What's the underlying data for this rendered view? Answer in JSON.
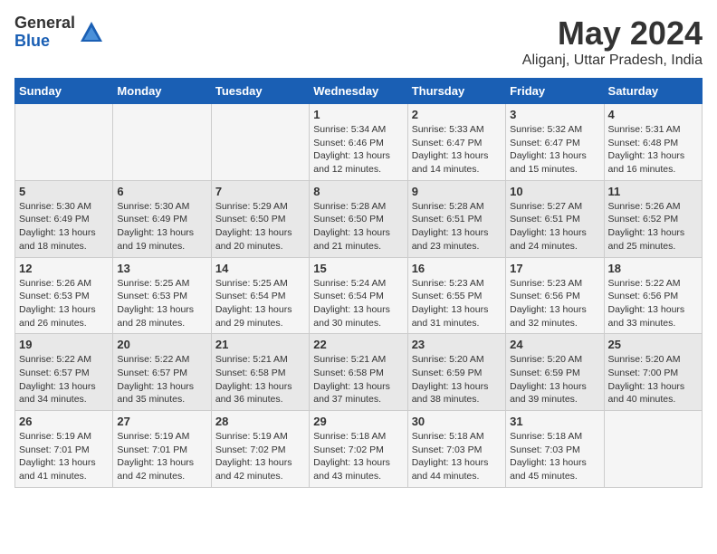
{
  "logo": {
    "general": "General",
    "blue": "Blue"
  },
  "title": "May 2024",
  "location": "Aliganj, Uttar Pradesh, India",
  "weekdays": [
    "Sunday",
    "Monday",
    "Tuesday",
    "Wednesday",
    "Thursday",
    "Friday",
    "Saturday"
  ],
  "weeks": [
    [
      {
        "day": "",
        "info": ""
      },
      {
        "day": "",
        "info": ""
      },
      {
        "day": "",
        "info": ""
      },
      {
        "day": "1",
        "info": "Sunrise: 5:34 AM\nSunset: 6:46 PM\nDaylight: 13 hours\nand 12 minutes."
      },
      {
        "day": "2",
        "info": "Sunrise: 5:33 AM\nSunset: 6:47 PM\nDaylight: 13 hours\nand 14 minutes."
      },
      {
        "day": "3",
        "info": "Sunrise: 5:32 AM\nSunset: 6:47 PM\nDaylight: 13 hours\nand 15 minutes."
      },
      {
        "day": "4",
        "info": "Sunrise: 5:31 AM\nSunset: 6:48 PM\nDaylight: 13 hours\nand 16 minutes."
      }
    ],
    [
      {
        "day": "5",
        "info": "Sunrise: 5:30 AM\nSunset: 6:49 PM\nDaylight: 13 hours\nand 18 minutes."
      },
      {
        "day": "6",
        "info": "Sunrise: 5:30 AM\nSunset: 6:49 PM\nDaylight: 13 hours\nand 19 minutes."
      },
      {
        "day": "7",
        "info": "Sunrise: 5:29 AM\nSunset: 6:50 PM\nDaylight: 13 hours\nand 20 minutes."
      },
      {
        "day": "8",
        "info": "Sunrise: 5:28 AM\nSunset: 6:50 PM\nDaylight: 13 hours\nand 21 minutes."
      },
      {
        "day": "9",
        "info": "Sunrise: 5:28 AM\nSunset: 6:51 PM\nDaylight: 13 hours\nand 23 minutes."
      },
      {
        "day": "10",
        "info": "Sunrise: 5:27 AM\nSunset: 6:51 PM\nDaylight: 13 hours\nand 24 minutes."
      },
      {
        "day": "11",
        "info": "Sunrise: 5:26 AM\nSunset: 6:52 PM\nDaylight: 13 hours\nand 25 minutes."
      }
    ],
    [
      {
        "day": "12",
        "info": "Sunrise: 5:26 AM\nSunset: 6:53 PM\nDaylight: 13 hours\nand 26 minutes."
      },
      {
        "day": "13",
        "info": "Sunrise: 5:25 AM\nSunset: 6:53 PM\nDaylight: 13 hours\nand 28 minutes."
      },
      {
        "day": "14",
        "info": "Sunrise: 5:25 AM\nSunset: 6:54 PM\nDaylight: 13 hours\nand 29 minutes."
      },
      {
        "day": "15",
        "info": "Sunrise: 5:24 AM\nSunset: 6:54 PM\nDaylight: 13 hours\nand 30 minutes."
      },
      {
        "day": "16",
        "info": "Sunrise: 5:23 AM\nSunset: 6:55 PM\nDaylight: 13 hours\nand 31 minutes."
      },
      {
        "day": "17",
        "info": "Sunrise: 5:23 AM\nSunset: 6:56 PM\nDaylight: 13 hours\nand 32 minutes."
      },
      {
        "day": "18",
        "info": "Sunrise: 5:22 AM\nSunset: 6:56 PM\nDaylight: 13 hours\nand 33 minutes."
      }
    ],
    [
      {
        "day": "19",
        "info": "Sunrise: 5:22 AM\nSunset: 6:57 PM\nDaylight: 13 hours\nand 34 minutes."
      },
      {
        "day": "20",
        "info": "Sunrise: 5:22 AM\nSunset: 6:57 PM\nDaylight: 13 hours\nand 35 minutes."
      },
      {
        "day": "21",
        "info": "Sunrise: 5:21 AM\nSunset: 6:58 PM\nDaylight: 13 hours\nand 36 minutes."
      },
      {
        "day": "22",
        "info": "Sunrise: 5:21 AM\nSunset: 6:58 PM\nDaylight: 13 hours\nand 37 minutes."
      },
      {
        "day": "23",
        "info": "Sunrise: 5:20 AM\nSunset: 6:59 PM\nDaylight: 13 hours\nand 38 minutes."
      },
      {
        "day": "24",
        "info": "Sunrise: 5:20 AM\nSunset: 6:59 PM\nDaylight: 13 hours\nand 39 minutes."
      },
      {
        "day": "25",
        "info": "Sunrise: 5:20 AM\nSunset: 7:00 PM\nDaylight: 13 hours\nand 40 minutes."
      }
    ],
    [
      {
        "day": "26",
        "info": "Sunrise: 5:19 AM\nSunset: 7:01 PM\nDaylight: 13 hours\nand 41 minutes."
      },
      {
        "day": "27",
        "info": "Sunrise: 5:19 AM\nSunset: 7:01 PM\nDaylight: 13 hours\nand 42 minutes."
      },
      {
        "day": "28",
        "info": "Sunrise: 5:19 AM\nSunset: 7:02 PM\nDaylight: 13 hours\nand 42 minutes."
      },
      {
        "day": "29",
        "info": "Sunrise: 5:18 AM\nSunset: 7:02 PM\nDaylight: 13 hours\nand 43 minutes."
      },
      {
        "day": "30",
        "info": "Sunrise: 5:18 AM\nSunset: 7:03 PM\nDaylight: 13 hours\nand 44 minutes."
      },
      {
        "day": "31",
        "info": "Sunrise: 5:18 AM\nSunset: 7:03 PM\nDaylight: 13 hours\nand 45 minutes."
      },
      {
        "day": "",
        "info": ""
      }
    ]
  ]
}
